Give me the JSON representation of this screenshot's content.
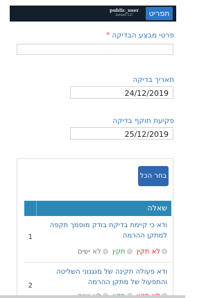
{
  "header": {
    "menu_label": "תפריט",
    "user_name": "public_user",
    "user_org": "Israel LC"
  },
  "form": {
    "executor_label": "פרטי מבצע הבדיקה",
    "required_marker": "*",
    "executor_value": "",
    "test_date_label": "תאריך בדיקה",
    "test_date_value": "24/12/2019",
    "expiry_label": "פקיעת תוקף בדיקה",
    "expiry_value": "25/12/2019"
  },
  "checklist": {
    "select_all_label": "בחר הכל",
    "column_header": "שאלה",
    "status_colors": {
      "not_ok": "#e0262e",
      "ok": "#2e9e3e",
      "na": "#777777"
    },
    "rows": [
      {
        "number": "1",
        "question": "ודא כי קיימת בדיקת בודק מוסמך תקפה למתקן ההרמה",
        "options": [
          "לא תקין",
          "תקין",
          "לא ישים"
        ]
      },
      {
        "number": "2",
        "question": "ודא פעולה תקינה של מנגנוני השליטה והתפעול של מתקן ההרמה",
        "options": [
          "לא תקין",
          "תקין",
          "לא ישים"
        ]
      }
    ]
  }
}
